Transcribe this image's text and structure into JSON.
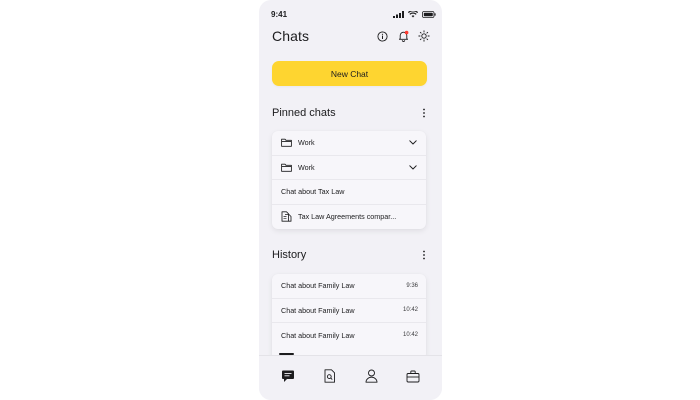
{
  "status": {
    "time": "9:41"
  },
  "header": {
    "title": "Chats",
    "icons": [
      "info-icon",
      "bell-icon",
      "sun-icon"
    ],
    "accent": "#ff3b30"
  },
  "new_chat": {
    "label": "New Chat",
    "color": "#fed530"
  },
  "pinned": {
    "title": "Pinned chats",
    "items": [
      {
        "icon": "folder-icon",
        "label": "Work",
        "expandable": true
      },
      {
        "icon": "folder-icon",
        "label": "Work",
        "expandable": true
      },
      {
        "icon": "",
        "label": "Chat about Tax Law",
        "expandable": false
      },
      {
        "icon": "document-icon",
        "label": "Tax Law Agreements compar...",
        "expandable": false
      }
    ]
  },
  "history": {
    "title": "History",
    "items": [
      {
        "label": "Chat about Family Law",
        "time": "9:36"
      },
      {
        "label": "Chat about Family Law",
        "time": "10:42"
      },
      {
        "label": "Chat about Family Law",
        "time": "10:42"
      }
    ]
  },
  "tabbar": {
    "tabs": [
      "chats-tab-icon",
      "document-search-icon",
      "profile-icon",
      "briefcase-icon"
    ]
  }
}
